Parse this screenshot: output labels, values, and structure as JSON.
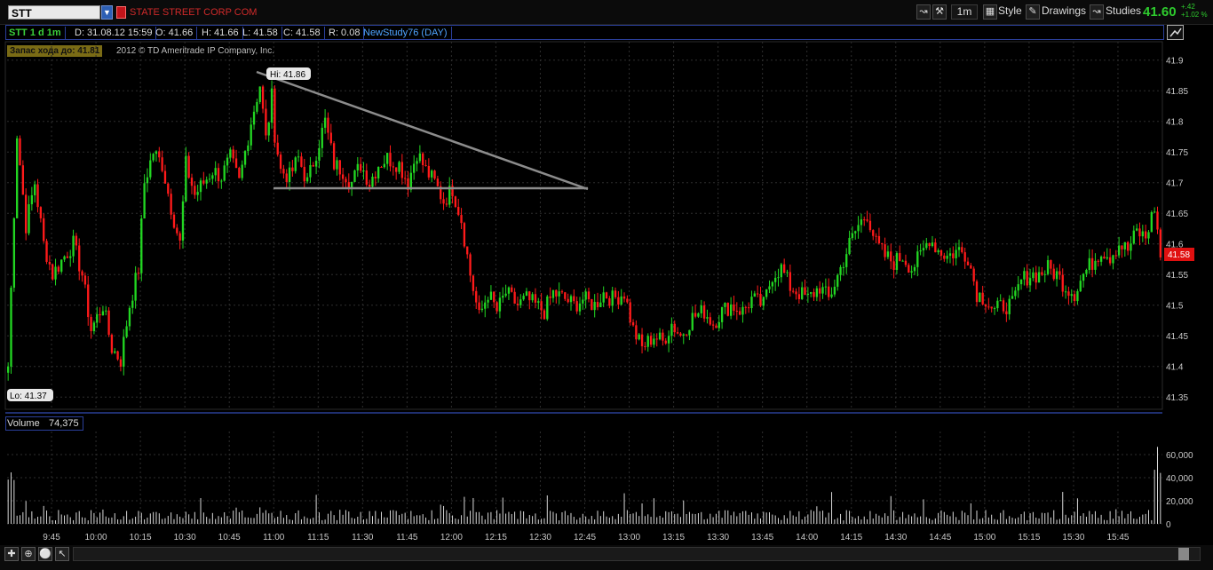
{
  "toolbar": {
    "symbol": "STT",
    "company": "STATE STREET CORP COM",
    "interval": "1m",
    "style_label": "Style",
    "drawings_label": "Drawings",
    "studies_label": "Studies",
    "last_price": "41.60",
    "change_abs": "+.42",
    "change_pct": "+1.02 %"
  },
  "infobar": {
    "symbol_period": "STT 1 d 1m",
    "date": "D: 31.08.12 15:59",
    "open": "O: 41.66",
    "high": "H: 41.66",
    "low": "L: 41.58",
    "close": "C: 41.58",
    "range": "R: 0.08",
    "study": "NewStudy76 (DAY)"
  },
  "banner": "Запас хода до: 41.81",
  "copyright": "2012 © TD Ameritrade IP Company, Inc.",
  "volume": {
    "label": "Volume",
    "value": "74,375"
  },
  "colors": {
    "up": "#22d622",
    "down": "#ff1a1a",
    "line": "#9a9a9a",
    "grid": "#2e2e2e",
    "axis": "#c8c8c8"
  },
  "chart_data": {
    "type": "candlestick",
    "x_ticks": [
      "9:45",
      "10:00",
      "10:15",
      "10:30",
      "10:45",
      "11:00",
      "11:15",
      "11:30",
      "11:45",
      "12:00",
      "12:15",
      "12:30",
      "12:45",
      "13:00",
      "13:15",
      "13:30",
      "13:45",
      "14:00",
      "14:15",
      "14:30",
      "14:45",
      "15:00",
      "15:15",
      "15:30",
      "15:45"
    ],
    "y_ticks": [
      "41.9",
      "41.85",
      "41.8",
      "41.75",
      "41.7",
      "41.65",
      "41.6",
      "41.55",
      "41.5",
      "41.45",
      "41.4",
      "41.35"
    ],
    "ylim": [
      41.33,
      41.93
    ],
    "hi_label": "Hi: 41.86",
    "lo_label": "Lo: 41.37",
    "last_label": "41.58",
    "price_path": [
      [
        "9:30",
        41.4
      ],
      [
        "9:33",
        41.78
      ],
      [
        "9:36",
        41.63
      ],
      [
        "9:39",
        41.7
      ],
      [
        "9:42",
        41.6
      ],
      [
        "9:45",
        41.55
      ],
      [
        "9:49",
        41.58
      ],
      [
        "9:52",
        41.6
      ],
      [
        "9:55",
        41.55
      ],
      [
        "9:58",
        41.46
      ],
      [
        "10:02",
        41.5
      ],
      [
        "10:05",
        41.43
      ],
      [
        "10:08",
        41.41
      ],
      [
        "10:11",
        41.5
      ],
      [
        "10:14",
        41.56
      ],
      [
        "10:16",
        41.7
      ],
      [
        "10:19",
        41.75
      ],
      [
        "10:22",
        41.73
      ],
      [
        "10:25",
        41.66
      ],
      [
        "10:28",
        41.6
      ],
      [
        "10:30",
        41.73
      ],
      [
        "10:33",
        41.68
      ],
      [
        "10:36",
        41.7
      ],
      [
        "10:39",
        41.72
      ],
      [
        "10:42",
        41.71
      ],
      [
        "10:45",
        41.74
      ],
      [
        "10:48",
        41.7
      ],
      [
        "10:52",
        41.8
      ],
      [
        "10:55",
        41.86
      ],
      [
        "10:57",
        41.77
      ],
      [
        "10:59",
        41.84
      ],
      [
        "11:00",
        41.78
      ],
      [
        "11:02",
        41.72
      ],
      [
        "11:05",
        41.71
      ],
      [
        "11:08",
        41.74
      ],
      [
        "11:11",
        41.7
      ],
      [
        "11:14",
        41.75
      ],
      [
        "11:17",
        41.8
      ],
      [
        "11:20",
        41.73
      ],
      [
        "11:23",
        41.72
      ],
      [
        "11:26",
        41.7
      ],
      [
        "11:29",
        41.73
      ],
      [
        "11:32",
        41.7
      ],
      [
        "11:35",
        41.73
      ],
      [
        "11:38",
        41.74
      ],
      [
        "11:42",
        41.73
      ],
      [
        "11:45",
        41.7
      ],
      [
        "11:48",
        41.75
      ],
      [
        "11:51",
        41.72
      ],
      [
        "11:54",
        41.7
      ],
      [
        "11:57",
        41.67
      ],
      [
        "12:00",
        41.69
      ],
      [
        "12:03",
        41.64
      ],
      [
        "12:06",
        41.55
      ],
      [
        "12:09",
        41.48
      ],
      [
        "12:12",
        41.52
      ],
      [
        "12:15",
        41.49
      ],
      [
        "12:18",
        41.52
      ],
      [
        "12:22",
        41.5
      ],
      [
        "12:25",
        41.51
      ],
      [
        "12:28",
        41.5
      ],
      [
        "12:31",
        41.49
      ],
      [
        "12:34",
        41.52
      ],
      [
        "12:38",
        41.51
      ],
      [
        "12:41",
        41.5
      ],
      [
        "12:44",
        41.51
      ],
      [
        "12:48",
        41.5
      ],
      [
        "12:51",
        41.52
      ],
      [
        "12:54",
        41.51
      ],
      [
        "12:58",
        41.52
      ],
      [
        "13:01",
        41.46
      ],
      [
        "13:04",
        41.43
      ],
      [
        "13:08",
        41.45
      ],
      [
        "13:11",
        41.44
      ],
      [
        "13:14",
        41.47
      ],
      [
        "13:17",
        41.45
      ],
      [
        "13:21",
        41.48
      ],
      [
        "13:25",
        41.49
      ],
      [
        "13:28",
        41.47
      ],
      [
        "13:31",
        41.49
      ],
      [
        "13:34",
        41.5
      ],
      [
        "13:38",
        41.49
      ],
      [
        "13:41",
        41.51
      ],
      [
        "13:45",
        41.5
      ],
      [
        "13:48",
        41.55
      ],
      [
        "13:51",
        41.56
      ],
      [
        "13:54",
        41.53
      ],
      [
        "13:57",
        41.52
      ],
      [
        "14:00",
        41.51
      ],
      [
        "14:04",
        41.53
      ],
      [
        "14:07",
        41.51
      ],
      [
        "14:11",
        41.56
      ],
      [
        "14:14",
        41.6
      ],
      [
        "14:17",
        41.63
      ],
      [
        "14:20",
        41.65
      ],
      [
        "14:23",
        41.6
      ],
      [
        "14:26",
        41.58
      ],
      [
        "14:29",
        41.57
      ],
      [
        "14:32",
        41.58
      ],
      [
        "14:35",
        41.56
      ],
      [
        "14:38",
        41.58
      ],
      [
        "14:41",
        41.61
      ],
      [
        "14:44",
        41.59
      ],
      [
        "14:47",
        41.58
      ],
      [
        "14:51",
        41.59
      ],
      [
        "14:54",
        41.58
      ],
      [
        "14:57",
        41.52
      ],
      [
        "15:00",
        41.51
      ],
      [
        "15:03",
        41.49
      ],
      [
        "15:06",
        41.5
      ],
      [
        "15:09",
        41.5
      ],
      [
        "15:12",
        41.54
      ],
      [
        "15:15",
        41.55
      ],
      [
        "15:18",
        41.55
      ],
      [
        "15:21",
        41.56
      ],
      [
        "15:24",
        41.55
      ],
      [
        "15:27",
        41.53
      ],
      [
        "15:30",
        41.52
      ],
      [
        "15:33",
        41.55
      ],
      [
        "15:36",
        41.57
      ],
      [
        "15:39",
        41.59
      ],
      [
        "15:42",
        41.58
      ],
      [
        "15:45",
        41.6
      ],
      [
        "15:48",
        41.59
      ],
      [
        "15:51",
        41.62
      ],
      [
        "15:54",
        41.61
      ],
      [
        "15:57",
        41.66
      ],
      [
        "15:59",
        41.58
      ]
    ],
    "volume_ticks": [
      "60,000",
      "40,000",
      "20,000",
      "0"
    ],
    "volume_ylim": [
      0,
      80000
    ]
  }
}
